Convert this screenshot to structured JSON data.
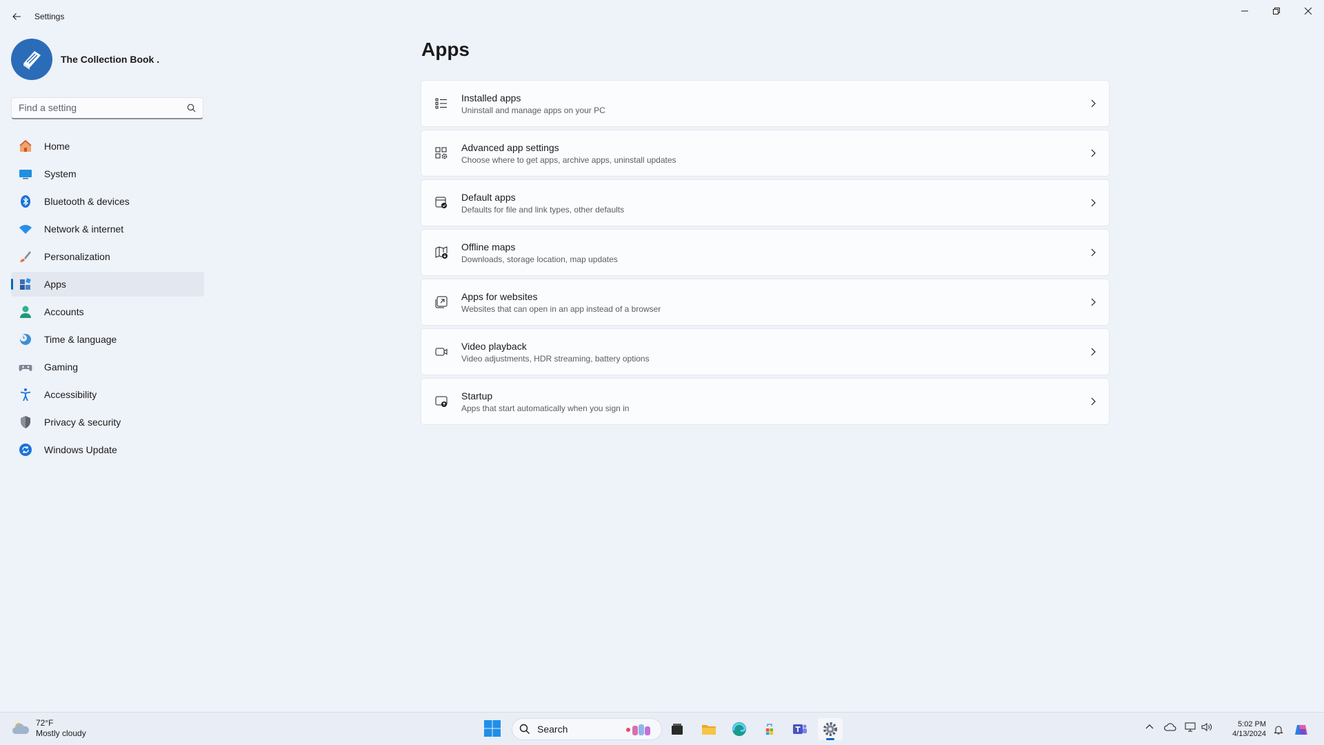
{
  "window": {
    "title": "Settings"
  },
  "profile": {
    "name": "The Collection Book ."
  },
  "search": {
    "placeholder": "Find a setting"
  },
  "nav": {
    "items": [
      {
        "label": "Home",
        "icon": "home-icon"
      },
      {
        "label": "System",
        "icon": "system-icon"
      },
      {
        "label": "Bluetooth & devices",
        "icon": "bluetooth-icon"
      },
      {
        "label": "Network & internet",
        "icon": "wifi-icon"
      },
      {
        "label": "Personalization",
        "icon": "brush-icon"
      },
      {
        "label": "Apps",
        "icon": "apps-icon",
        "active": true
      },
      {
        "label": "Accounts",
        "icon": "accounts-icon"
      },
      {
        "label": "Time & language",
        "icon": "clock-globe-icon"
      },
      {
        "label": "Gaming",
        "icon": "gamepad-icon"
      },
      {
        "label": "Accessibility",
        "icon": "accessibility-icon"
      },
      {
        "label": "Privacy & security",
        "icon": "shield-icon"
      },
      {
        "label": "Windows Update",
        "icon": "update-icon"
      }
    ]
  },
  "main": {
    "title": "Apps",
    "cards": [
      {
        "title": "Installed apps",
        "desc": "Uninstall and manage apps on your PC",
        "icon": "list-icon"
      },
      {
        "title": "Advanced app settings",
        "desc": "Choose where to get apps, archive apps, uninstall updates",
        "icon": "app-gear-icon"
      },
      {
        "title": "Default apps",
        "desc": "Defaults for file and link types, other defaults",
        "icon": "default-apps-icon"
      },
      {
        "title": "Offline maps",
        "desc": "Downloads, storage location, map updates",
        "icon": "map-download-icon"
      },
      {
        "title": "Apps for websites",
        "desc": "Websites that can open in an app instead of a browser",
        "icon": "open-external-icon"
      },
      {
        "title": "Video playback",
        "desc": "Video adjustments, HDR streaming, battery options",
        "icon": "video-icon"
      },
      {
        "title": "Startup",
        "desc": "Apps that start automatically when you sign in",
        "icon": "startup-icon"
      }
    ]
  },
  "taskbar": {
    "weather_temp": "72°F",
    "weather_desc": "Mostly cloudy",
    "search_label": "Search",
    "time": "5:02 PM",
    "date": "4/13/2024"
  },
  "colors": {
    "accent": "#0067c0",
    "background": "#eef2f9",
    "card": "#fbfcfe"
  }
}
